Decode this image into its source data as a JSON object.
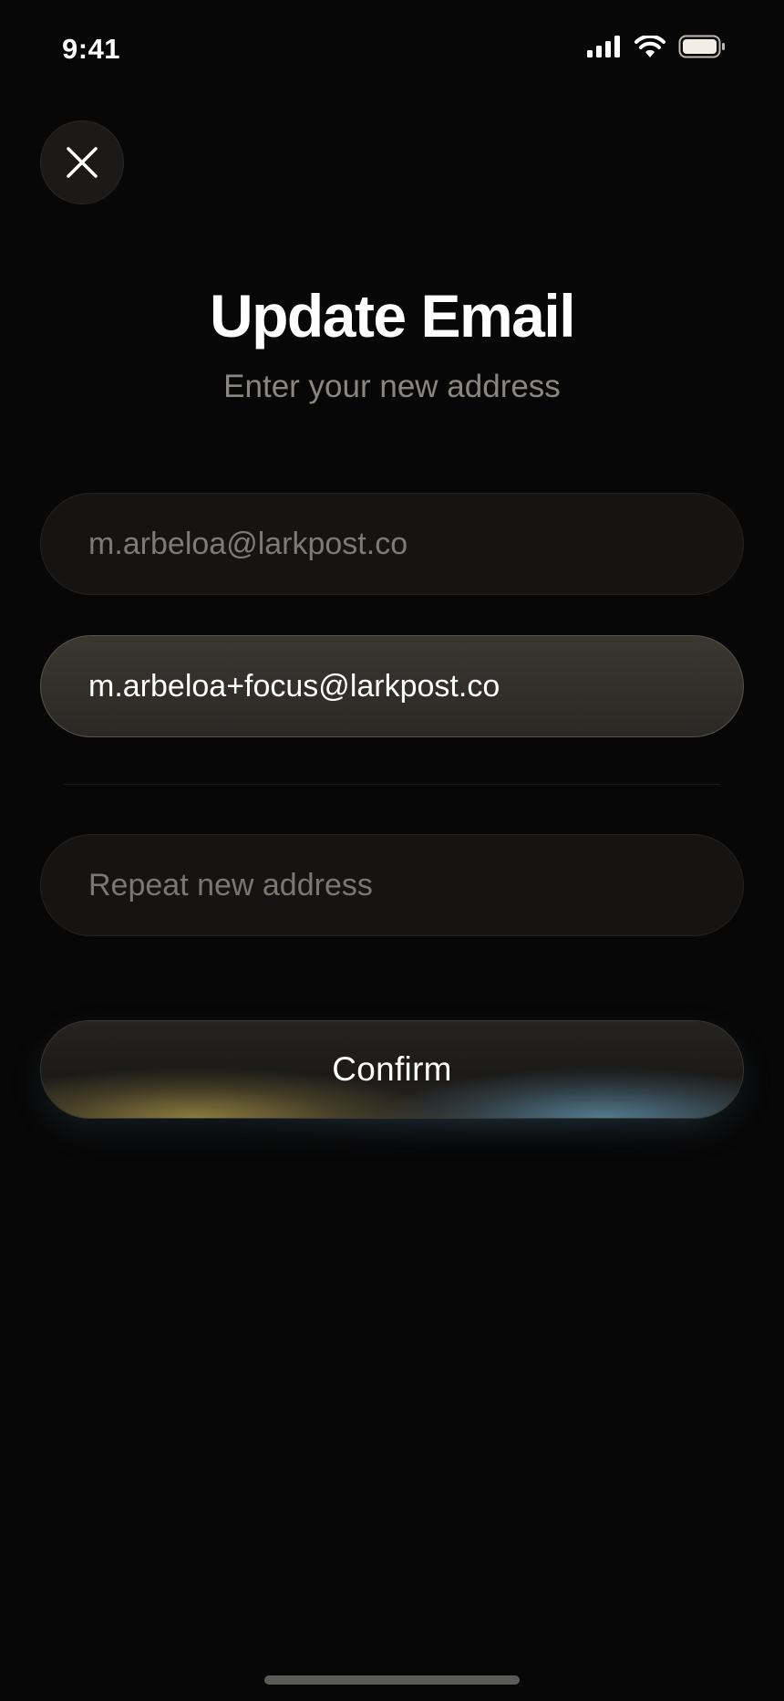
{
  "status_bar": {
    "time": "9:41",
    "icons": [
      "cellular-signal-icon",
      "wifi-icon",
      "battery-icon"
    ]
  },
  "header": {
    "close_icon": "close-icon",
    "title": "Update Email",
    "subtitle": "Enter your new address"
  },
  "form": {
    "current_email": {
      "value": "m.arbeloa@larkpost.co"
    },
    "new_email": {
      "value": "m.arbeloa+focus@larkpost.co"
    },
    "repeat_email": {
      "value": "",
      "placeholder": "Repeat new address"
    },
    "confirm_label": "Confirm"
  },
  "colors": {
    "background": "#080707",
    "field_background": "#151413",
    "focused_field_background": "#34312c",
    "accent_gold": "#aa9646",
    "accent_blue": "#5f96b4"
  }
}
